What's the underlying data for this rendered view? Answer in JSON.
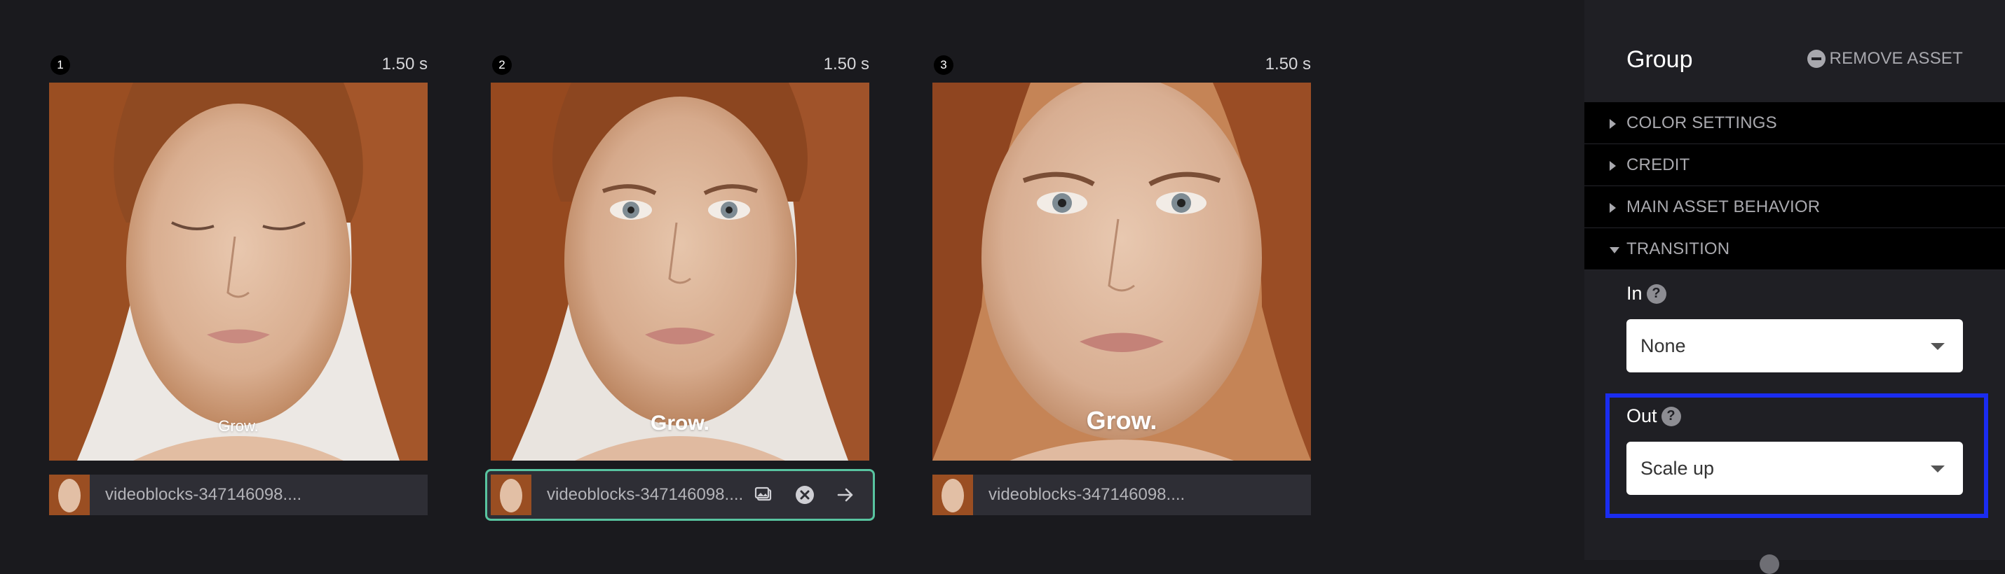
{
  "frames": [
    {
      "number": "1",
      "duration": "1.50 s",
      "caption": "Grow.",
      "asset_name": "videoblocks-347146098...."
    },
    {
      "number": "2",
      "duration": "1.50 s",
      "caption": "Grow.",
      "asset_name": "videoblocks-347146098...."
    },
    {
      "number": "3",
      "duration": "1.50 s",
      "caption": "Grow.",
      "asset_name": "videoblocks-347146098...."
    }
  ],
  "panel": {
    "title": "Group",
    "remove_label": "REMOVE ASSET",
    "sections": [
      {
        "label": "COLOR SETTINGS",
        "expanded": false
      },
      {
        "label": "CREDIT",
        "expanded": false
      },
      {
        "label": "MAIN ASSET BEHAVIOR",
        "expanded": false
      },
      {
        "label": "TRANSITION",
        "expanded": true
      }
    ],
    "transition": {
      "in_label": "In",
      "in_value": "None",
      "out_label": "Out",
      "out_value": "Scale up",
      "help_glyph": "?"
    }
  },
  "colors": {
    "background": "#1a1a1e",
    "panel_bg": "#1f1f24",
    "selected_border": "#58c4a0",
    "highlight_border": "#1a2cf0"
  },
  "icons": [
    "image-icon",
    "close-circle-icon",
    "arrow-right-icon",
    "help-icon",
    "remove-icon",
    "caret-right-icon",
    "caret-down-icon",
    "dropdown-arrow-icon"
  ]
}
